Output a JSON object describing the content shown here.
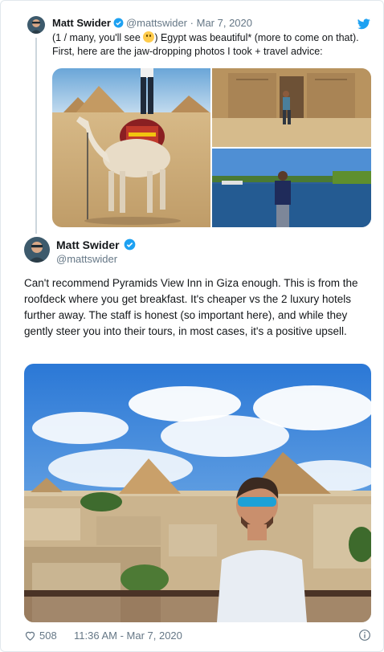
{
  "tweet1": {
    "author_name": "Matt Swider",
    "handle": "@mattswider",
    "separator": "·",
    "date": "Mar 7, 2020",
    "text_before_emoji": "(1 / many, you'll see",
    "text_after_emoji": ") Egypt was beautiful* (more to come on that). First, here are the jaw-dropping photos I took + travel advice:"
  },
  "tweet2": {
    "author_name": "Matt Swider",
    "handle": "@mattswider",
    "text": "Can't recommend Pyramids View Inn in Giza enough. This is from the roofdeck where you get breakfast. It's cheaper vs the 2 luxury hotels further away. The staff is honest (so important here), and while they gently steer you into their tours, in most cases, it's a positive upsell.",
    "likes": "508",
    "timestamp": "11:36 AM - Mar 7, 2020"
  },
  "icons": {
    "verified": "verified-badge-icon",
    "bird": "twitter-bird-icon",
    "heart": "heart-icon",
    "info": "info-icon",
    "emoji": "flushed-face-emoji"
  },
  "colors": {
    "brand_blue": "#1da1f2",
    "muted": "#657786",
    "text": "#14171a",
    "border": "#e1e8ed"
  }
}
